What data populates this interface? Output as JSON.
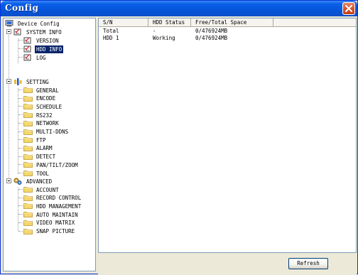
{
  "window": {
    "title": "Config",
    "title_bar_color": "#0a5fe8",
    "close_icon": "close-icon"
  },
  "tree": {
    "root": {
      "label": "Device Config",
      "icon": "computer-icon"
    },
    "system_info": {
      "label": "SYSTEM INFO",
      "icon": "checklist-icon",
      "children": [
        {
          "label": "VERSION",
          "icon": "checklist-icon"
        },
        {
          "label": "HDD INFO",
          "icon": "checklist-icon",
          "selected": true
        },
        {
          "label": "LOG",
          "icon": "checklist-icon"
        }
      ]
    },
    "setting": {
      "label": "SETTING",
      "icon": "setting-icon",
      "children": [
        {
          "label": "GENERAL"
        },
        {
          "label": "ENCODE"
        },
        {
          "label": "SCHEDULE"
        },
        {
          "label": "RS232"
        },
        {
          "label": "NETWORK"
        },
        {
          "label": "MULTI-DDNS"
        },
        {
          "label": "FTP"
        },
        {
          "label": "ALARM"
        },
        {
          "label": "DETECT"
        },
        {
          "label": "PAN/TILT/ZOOM"
        },
        {
          "label": "TOOL"
        }
      ]
    },
    "advanced": {
      "label": "ADVANCED",
      "icon": "gears-icon",
      "children": [
        {
          "label": "ACCOUNT"
        },
        {
          "label": "RECORD CONTROL"
        },
        {
          "label": "HDD MANAGEMENT"
        },
        {
          "label": "AUTO MAINTAIN"
        },
        {
          "label": "VIDEO MATRIX"
        },
        {
          "label": "SNAP PICTURE"
        }
      ]
    }
  },
  "table": {
    "columns": [
      "S/N",
      "HDD Status",
      "Free/Total Space"
    ],
    "rows": [
      {
        "sn": "Total",
        "status": "-",
        "space": "0/476924MB"
      },
      {
        "sn": "HDD 1",
        "status": "Working",
        "space": "0/476924MB"
      }
    ]
  },
  "actions": {
    "refresh_label": "Refresh"
  },
  "colors": {
    "selection": "#0a246a",
    "folder": "#f5d76e",
    "window_bg": "#ece9d8"
  }
}
